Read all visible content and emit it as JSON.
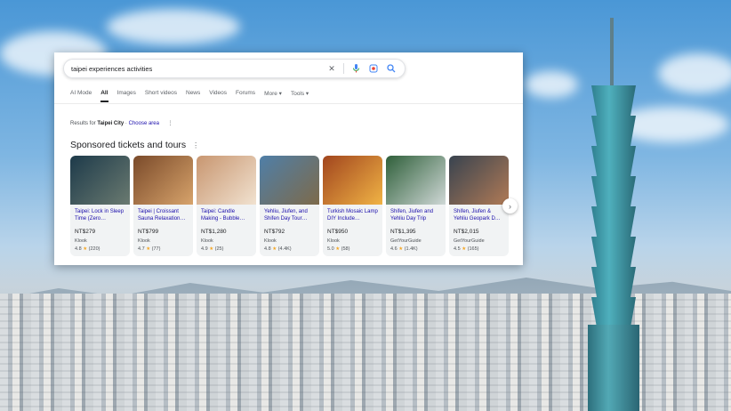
{
  "search": {
    "query": "taipei experiences activities",
    "icons": [
      "close-icon",
      "microphone-icon",
      "lens-icon",
      "search-icon"
    ]
  },
  "tabs": [
    {
      "label": "AI Mode"
    },
    {
      "label": "All"
    },
    {
      "label": "Images"
    },
    {
      "label": "Short videos"
    },
    {
      "label": "News"
    },
    {
      "label": "Videos"
    },
    {
      "label": "Forums"
    },
    {
      "label": "More ▾"
    },
    {
      "label": "Tools ▾"
    }
  ],
  "results": {
    "prefix": "Results for",
    "location": "Taipei City",
    "separator": " · ",
    "choose": "Choose area",
    "more": "⋮"
  },
  "sponsored": {
    "heading": "Sponsored tickets and tours",
    "info": "⋮"
  },
  "tiles": [
    {
      "title": "Taipei: Lock in Sleep Time (Zero…",
      "price": "NT$279",
      "vendor": "Klook",
      "rating": "4.8",
      "reviews": "(220)",
      "colors": [
        "#1d3a4a",
        "#6a7a70"
      ]
    },
    {
      "title": "Taipei | Croissant Sauna Relaxation…",
      "price": "NT$799",
      "vendor": "Klook",
      "rating": "4.7",
      "reviews": "(77)",
      "colors": [
        "#7a4a2a",
        "#d7a36b"
      ]
    },
    {
      "title": "Taipei: Candle Making - Bubble…",
      "price": "NT$1,280",
      "vendor": "Klook",
      "rating": "4.9",
      "reviews": "(25)",
      "colors": [
        "#c89670",
        "#f1e2d0"
      ]
    },
    {
      "title": "Yehliu, Jiufen, and Shifen Day Tour…",
      "price": "NT$792",
      "vendor": "Klook",
      "rating": "4.8",
      "reviews": "(4.4K)",
      "colors": [
        "#4f7fa8",
        "#7d6a4a"
      ]
    },
    {
      "title": "Turkish Mosaic Lamp DIY Include…",
      "price": "NT$950",
      "vendor": "Klook",
      "rating": "5.0",
      "reviews": "(58)",
      "colors": [
        "#a1451e",
        "#f0b345"
      ]
    },
    {
      "title": "Shifen, Jiufen and Yehliu Day Trip",
      "price": "NT$1,395",
      "vendor": "GetYourGuide",
      "rating": "4.6",
      "reviews": "(1.4K)",
      "colors": [
        "#2f5f3a",
        "#cfd8d6"
      ]
    },
    {
      "title": "Shifen, Jiufen & Yehliu Geopark D…",
      "price": "NT$2,015",
      "vendor": "GetYourGuide",
      "rating": "4.5",
      "reviews": "(165)",
      "colors": [
        "#38434f",
        "#b07a56"
      ]
    }
  ],
  "next_icon": "chevron-right-icon"
}
